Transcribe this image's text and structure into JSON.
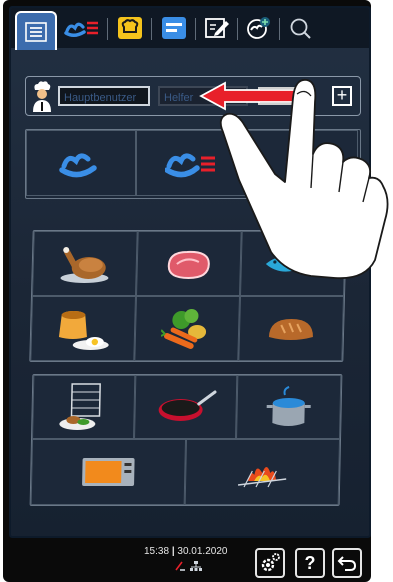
{
  "tabs": [
    {
      "icon": "menu-icon",
      "active": true
    },
    {
      "icon": "intelligent-cooking-icon"
    },
    {
      "icon": "chef-hat-icon"
    },
    {
      "icon": "programming-icon"
    },
    {
      "icon": "edit-icon"
    },
    {
      "icon": "add-cooking-icon"
    },
    {
      "icon": "search-icon"
    }
  ],
  "user_profiles": {
    "main_user": "Hauptbenutzer",
    "second_user": "Helfer"
  },
  "status": {
    "time": "15:38",
    "date": "30.01.2020"
  },
  "colors": {
    "accent": "#3c6cad",
    "arrow": "#e8202a",
    "hat_yellow": "#f4c31c",
    "steam_blue": "#3a8ee6"
  }
}
